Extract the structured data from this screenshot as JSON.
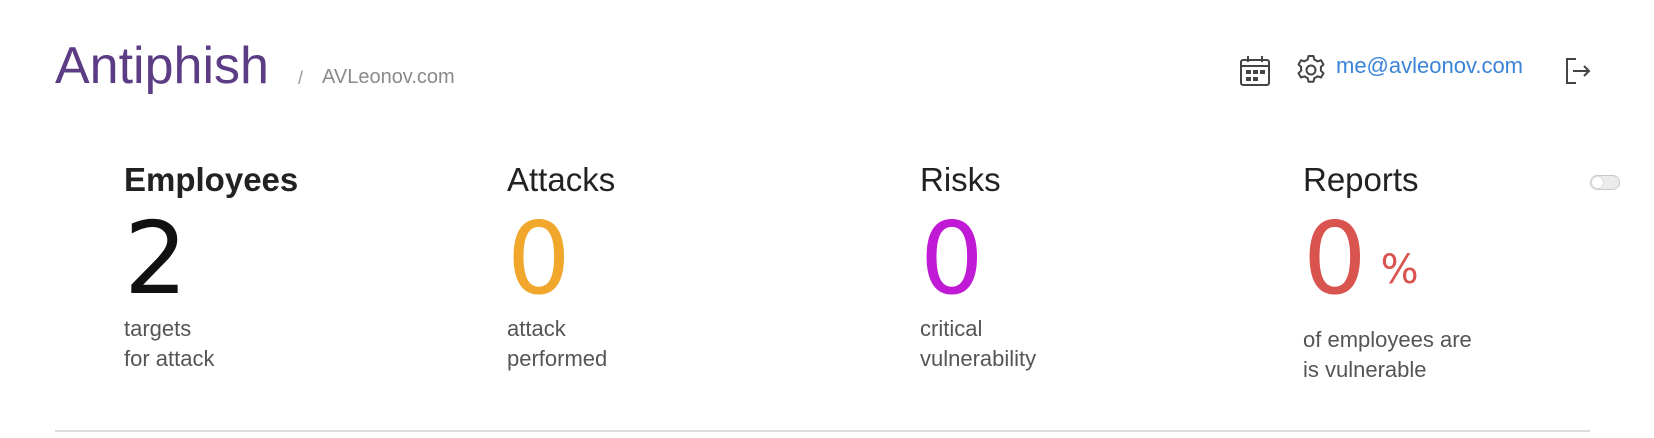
{
  "header": {
    "brand": "Antiphish",
    "separator": "/",
    "organization": "AVLeonov.com",
    "user_email": "me@avleonov.com",
    "icons": [
      "calendar-icon",
      "gear-icon",
      "logout-icon"
    ]
  },
  "stats": {
    "employees": {
      "title": "Employees",
      "value": "2",
      "line1": "targets",
      "line2": "for attack",
      "color": "#111111"
    },
    "attacks": {
      "title": "Attacks",
      "value": "0",
      "line1": "attack",
      "line2": "performed",
      "color": "#f0a72b"
    },
    "risks": {
      "title": "Risks",
      "value": "0",
      "line1": "critical",
      "line2": "vulnerability",
      "color": "#c11ad6"
    },
    "reports": {
      "title": "Reports",
      "value": "0",
      "unit": "%",
      "line1": "of employees are",
      "line2": "is vulnerable",
      "color": "#d9534f"
    }
  },
  "colors": {
    "brand": "#5b3c85",
    "link": "#3a83d8"
  }
}
